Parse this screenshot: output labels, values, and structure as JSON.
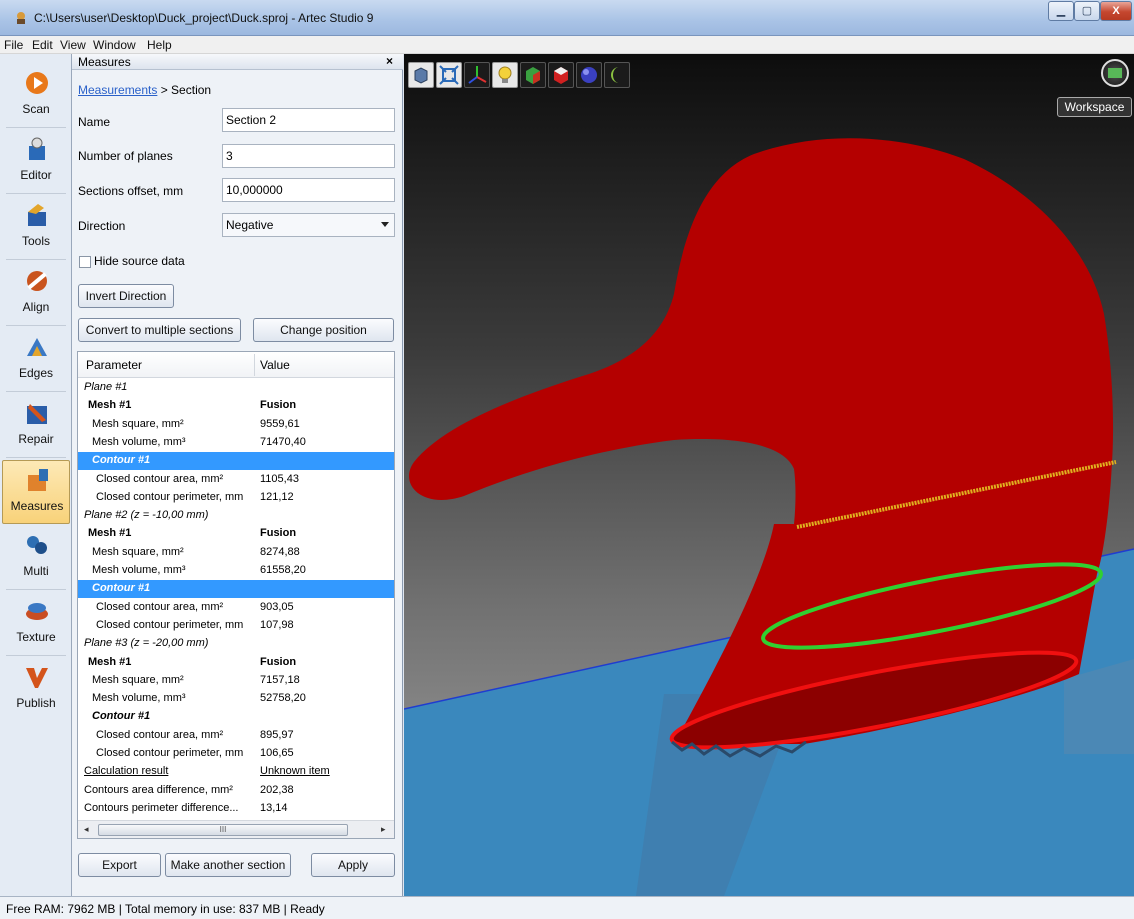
{
  "window": {
    "title": "C:\\Users\\user\\Desktop\\Duck_project\\Duck.sproj - Artec Studio 9",
    "min": "▁",
    "max": "▢",
    "close": "X"
  },
  "menu": [
    "File",
    "Edit",
    "View",
    "Window",
    "Help"
  ],
  "tools": [
    {
      "label": "Scan",
      "icon": "scan-icon",
      "color": "#e8781a"
    },
    {
      "label": "Editor",
      "icon": "editor-icon",
      "color": "#2a6ab8"
    },
    {
      "label": "Tools",
      "icon": "tools-icon",
      "color": "#e3a52b"
    },
    {
      "label": "Align",
      "icon": "align-icon",
      "color": "#c9541e"
    },
    {
      "label": "Edges",
      "icon": "edges-icon",
      "color": "#3a78c4"
    },
    {
      "label": "Repair",
      "icon": "repair-icon",
      "color": "#2a5da8"
    },
    {
      "label": "Measures",
      "icon": "measures-icon",
      "color": "#e0822c"
    },
    {
      "label": "Multi",
      "icon": "multi-icon",
      "color": "#2e6fb3"
    },
    {
      "label": "Texture",
      "icon": "texture-icon",
      "color": "#c94d22"
    },
    {
      "label": "Publish",
      "icon": "publish-icon",
      "color": "#d4541b"
    }
  ],
  "panel": {
    "title": "Measures",
    "close": "×",
    "breadcrumb_link": "Measurements",
    "breadcrumb_rest": " > Section",
    "name_label": "Name",
    "name_value": "Section 2",
    "planes_label": "Number of planes",
    "planes_value": "3",
    "offset_label": "Sections offset, mm",
    "offset_value": "10,000000",
    "direction_label": "Direction",
    "direction_value": "Negative",
    "hide_label": "Hide source data",
    "invert_btn": "Invert Direction",
    "convert_btn": "Convert to multiple sections",
    "change_btn": "Change position",
    "export_btn": "Export",
    "another_btn": "Make another section",
    "apply_btn": "Apply"
  },
  "table": {
    "col_param": "Parameter",
    "col_value": "Value",
    "rows": [
      {
        "p": "Plane #1",
        "v": "",
        "kind": "plane",
        "indent": 0
      },
      {
        "p": "Mesh #1",
        "v": "Fusion",
        "kind": "bold",
        "indent": 1
      },
      {
        "p": "Mesh square, mm²",
        "v": "9559,61",
        "kind": "normal",
        "indent": 2
      },
      {
        "p": "Mesh volume, mm³",
        "v": "71470,40",
        "kind": "normal",
        "indent": 2
      },
      {
        "p": "Contour #1",
        "v": "",
        "kind": "sel",
        "indent": 2
      },
      {
        "p": "Closed contour area, mm²",
        "v": "1105,43",
        "kind": "normal",
        "indent": 3
      },
      {
        "p": "Closed contour perimeter, mm",
        "v": "121,12",
        "kind": "normal",
        "indent": 3
      },
      {
        "p": "Plane #2 (z = -10,00 mm)",
        "v": "",
        "kind": "plane",
        "indent": 0
      },
      {
        "p": "Mesh #1",
        "v": "Fusion",
        "kind": "bold",
        "indent": 1
      },
      {
        "p": "Mesh square, mm²",
        "v": "8274,88",
        "kind": "normal",
        "indent": 2
      },
      {
        "p": "Mesh volume, mm³",
        "v": "61558,20",
        "kind": "normal",
        "indent": 2
      },
      {
        "p": "Contour #1",
        "v": "",
        "kind": "sel",
        "indent": 2
      },
      {
        "p": "Closed contour area, mm²",
        "v": "903,05",
        "kind": "normal",
        "indent": 3
      },
      {
        "p": "Closed contour perimeter, mm",
        "v": "107,98",
        "kind": "normal",
        "indent": 3
      },
      {
        "p": "Plane #3 (z = -20,00 mm)",
        "v": "",
        "kind": "plane",
        "indent": 0
      },
      {
        "p": "Mesh #1",
        "v": "Fusion",
        "kind": "bold",
        "indent": 1
      },
      {
        "p": "Mesh square, mm²",
        "v": "7157,18",
        "kind": "normal",
        "indent": 2
      },
      {
        "p": "Mesh volume, mm³",
        "v": "52758,20",
        "kind": "normal",
        "indent": 2
      },
      {
        "p": "Contour #1",
        "v": "",
        "kind": "contour",
        "indent": 2
      },
      {
        "p": "Closed contour area, mm²",
        "v": "895,97",
        "kind": "normal",
        "indent": 3
      },
      {
        "p": "Closed contour perimeter, mm",
        "v": "106,65",
        "kind": "normal",
        "indent": 3
      },
      {
        "p": "Calculation result",
        "v": "Unknown item",
        "kind": "link",
        "indent": 0
      },
      {
        "p": "Contours area difference, mm²",
        "v": "202,38",
        "kind": "normal",
        "indent": 0
      },
      {
        "p": "Contours perimeter difference...",
        "v": "13,14",
        "kind": "normal",
        "indent": 0
      }
    ]
  },
  "viewport": {
    "workspace_label": "Workspace",
    "toolbar_icons": [
      "view-cube-icon",
      "fit-view-icon",
      "axes-icon",
      "light-bulb-icon",
      "texture-cube-icon",
      "shaded-cube-icon",
      "sphere-icon",
      "moon-icon"
    ],
    "model_color": "#b00000",
    "contour_colors": [
      "#e0b020",
      "#30d030",
      "#f01010"
    ]
  },
  "status": {
    "text": "Free RAM: 7962 MB  |  Total memory in use: 837 MB  |    Ready"
  }
}
